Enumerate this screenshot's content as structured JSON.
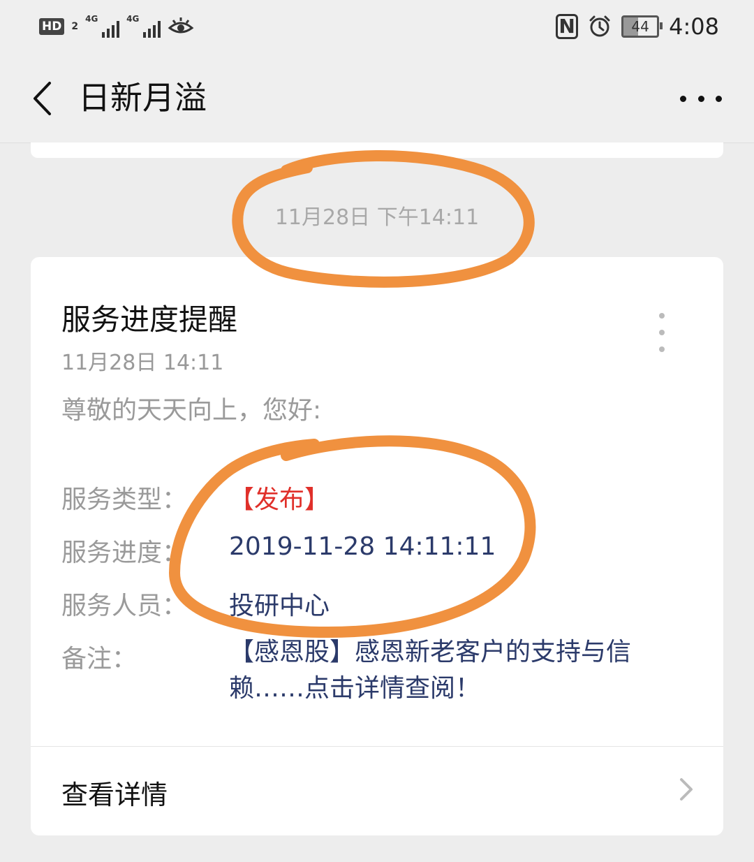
{
  "status_bar": {
    "hd_label": "HD",
    "hd_sub": "2",
    "network_1": "4G",
    "network_2": "4G",
    "nfc_label": "N",
    "battery_level": "44",
    "time": "4:08"
  },
  "nav": {
    "title": "日新月溢"
  },
  "timestamp": "11月28日 下午14:11",
  "card": {
    "title": "服务进度提醒",
    "date": "11月28日  14:11",
    "greeting": "尊敬的天天向上，您好:",
    "fields": [
      {
        "label": "服务类型：",
        "value": "【发布】"
      },
      {
        "label": "服务进度：",
        "value": "2019-11-28 14:11:11"
      },
      {
        "label": "服务人员：",
        "value": "投研中心"
      },
      {
        "label": "备注：",
        "value": "【感恩股】感恩新老客户的支持与信赖……点击详情查阅！"
      }
    ],
    "details_label": "查看详情"
  },
  "colors": {
    "annotation": "#f0913f",
    "value_blue": "#2b3a6a",
    "value_red": "#e0302a"
  }
}
